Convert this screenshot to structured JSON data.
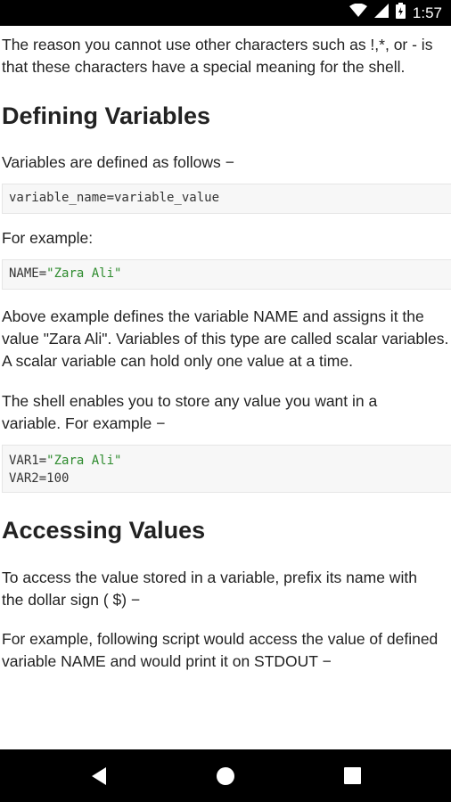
{
  "status_bar": {
    "time": "1:57",
    "icons": [
      "wifi-icon",
      "signal-icon",
      "battery-icon"
    ]
  },
  "article": {
    "intro": "The reason you cannot use other characters such as !,*, or - is that these characters have a special meaning for the shell.",
    "section1_title": "Defining Variables",
    "defined_text": "Variables are defined as follows −",
    "code1": "variable_name=variable_value",
    "for_example": "For example:",
    "code2_var": "NAME=",
    "code2_str": "\"Zara Ali\"",
    "above_text": "Above example defines the variable NAME and assigns it the value \"Zara Ali\". Variables of this type are called scalar variables. A scalar variable can hold only one value at a time.",
    "shell_text": "The shell enables you to store any value you want in a variable. For example −",
    "code3_line1_var": "VAR1=",
    "code3_line1_str": "\"Zara Ali\"",
    "code3_line2": "VAR2=100",
    "section2_title": "Accessing Values",
    "access_text": "To access the value stored in a variable, prefix its name with the dollar sign ( $) −",
    "followup_text": "For example, following script would access the value of defined variable NAME and would print it on STDOUT −"
  },
  "nav_bar": {
    "icons": [
      "back-icon",
      "home-icon",
      "recents-icon"
    ]
  }
}
